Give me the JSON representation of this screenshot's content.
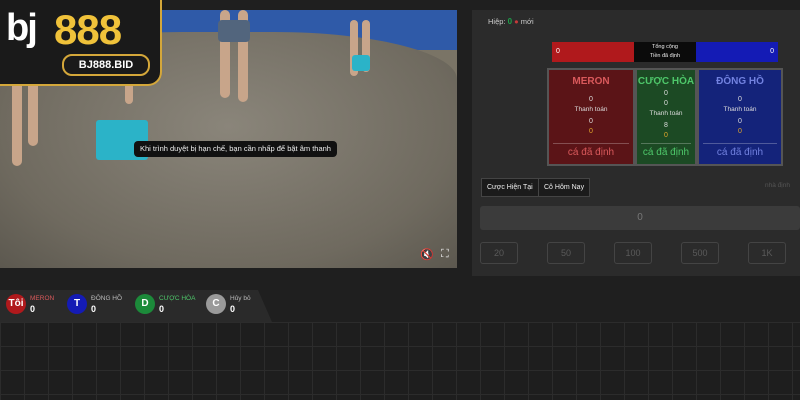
{
  "logo": {
    "text": "bj888",
    "domain": "BJ888.BID"
  },
  "video": {
    "subtitle": "Khi trình duyệt bị hạn chế, bạn cần nhấp để bật âm thanh",
    "mute_icon": "mute-icon",
    "fullscreen_icon": "fullscreen-icon"
  },
  "round": {
    "label": "Hiệp:",
    "number": "0",
    "status": "mới"
  },
  "totals": {
    "meron": "0",
    "middle_line1": "Tổng cộng",
    "middle_line2": "Tiền đã định",
    "wala": "0"
  },
  "bets": {
    "meron": {
      "title": "MERON",
      "v1": "0",
      "pay_label": "Thanh toán",
      "v2": "0",
      "v3": "0",
      "settled": "cá đã định"
    },
    "draw": {
      "title": "CƯỢC HÒA",
      "v1": "0",
      "v1b": "0",
      "pay_label": "Thanh toán",
      "v2": "8",
      "v3": "0",
      "settled": "cá đã định"
    },
    "wala": {
      "title": "ĐÔNG HỒ",
      "v1": "0",
      "pay_label": "Thanh toán",
      "v2": "0",
      "v3": "0",
      "settled": "cá đã định"
    }
  },
  "tabs": {
    "current": "Cược Hiện Tại",
    "today": "Cô Hôm Nay"
  },
  "faint_right": "nhà định",
  "amount_value": "0",
  "chips": [
    "20",
    "50",
    "100",
    "500",
    "1K"
  ],
  "stats": [
    {
      "badge": "Tôi",
      "name": "MERON",
      "count": "0",
      "color": "#b0191c",
      "name_color": "#d9595b"
    },
    {
      "badge": "T",
      "name": "ĐÔNG HỒ",
      "count": "0",
      "color": "#141bb5",
      "name_color": "#bbbbbb"
    },
    {
      "badge": "D",
      "name": "CƯỢC HÒA",
      "count": "0",
      "color": "#1c8a3a",
      "name_color": "#4ec76a"
    },
    {
      "badge": "C",
      "name": "Hủy bỏ",
      "count": "0",
      "color": "#9a9a9a",
      "name_color": "#bbbbbb"
    }
  ]
}
